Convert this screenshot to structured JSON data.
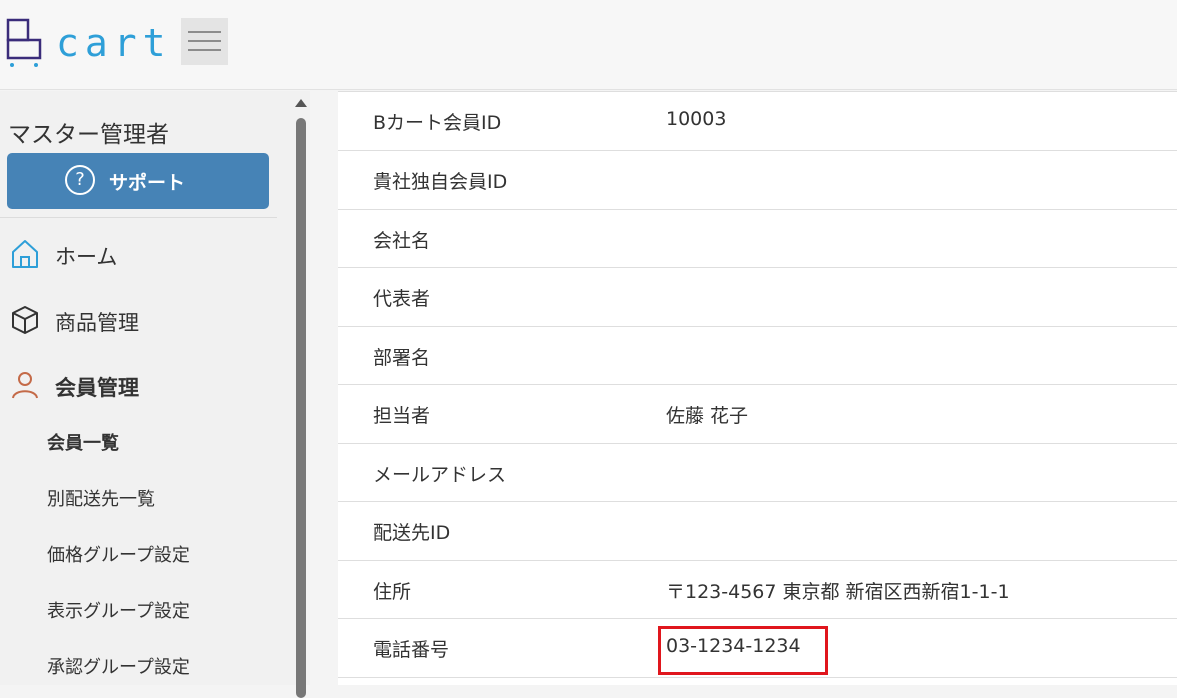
{
  "header": {
    "logo_text": "cart",
    "menu_button_icon": "hamburger-icon"
  },
  "sidebar": {
    "admin_name": "マスター管理者",
    "support_label": "サポート",
    "support_icon": "question-circle-icon",
    "nav": [
      {
        "label": "ホーム",
        "icon": "home-icon"
      },
      {
        "label": "商品管理",
        "icon": "box-icon"
      },
      {
        "label": "会員管理",
        "icon": "person-icon",
        "active": true
      }
    ],
    "sub_items": [
      "会員一覧",
      "別配送先一覧",
      "価格グループ設定",
      "表示グループ設定",
      "承認グループ設定"
    ],
    "scroll_up_icon": "scroll-up-arrow-icon"
  },
  "details": {
    "rows": [
      {
        "key": "Bカート会員ID",
        "value": "10003"
      },
      {
        "key": "貴社独自会員ID",
        "value": ""
      },
      {
        "key": "会社名",
        "value": ""
      },
      {
        "key": "代表者",
        "value": ""
      },
      {
        "key": "部署名",
        "value": ""
      },
      {
        "key": "担当者",
        "value": "佐藤 花子"
      },
      {
        "key": "メールアドレス",
        "value": ""
      },
      {
        "key": "配送先ID",
        "value": ""
      },
      {
        "key": "住所",
        "value": "〒123-4567 東京都 新宿区西新宿1-1-1"
      },
      {
        "key": "電話番号",
        "value": "03-1234-1234"
      }
    ]
  },
  "colors": {
    "brand_blue": "#2e9fd8",
    "logo_dark": "#3a2c7a",
    "support_button": "#4683b6",
    "highlight_red": "#e0161d"
  }
}
